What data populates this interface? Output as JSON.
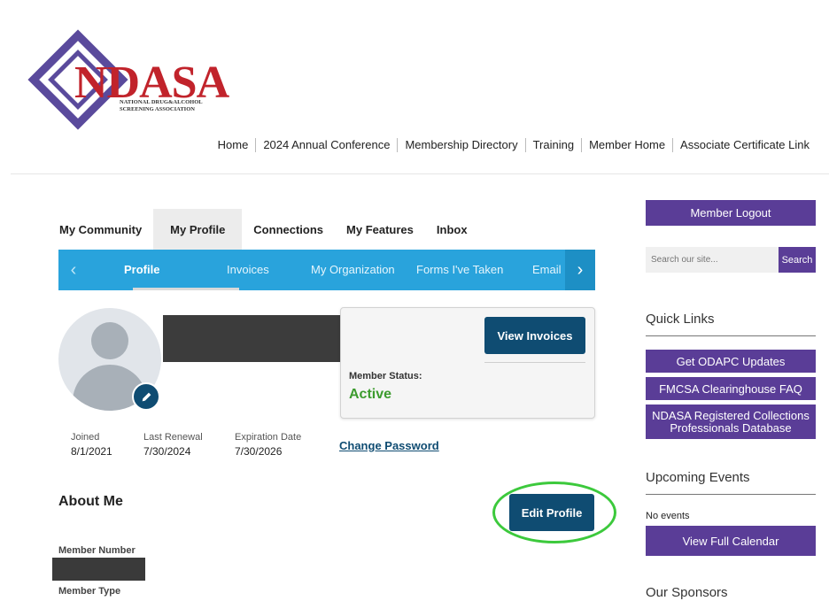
{
  "header": {
    "logo_text": "NDASA",
    "logo_subtitle_line1": "NATIONAL DRUG&ALCOHOL",
    "logo_subtitle_line2": "SCREENING ASSOCIATION",
    "nav": [
      "Home",
      "2024 Annual Conference",
      "Membership Directory",
      "Training",
      "Member Home",
      "Associate Certificate Link"
    ]
  },
  "community_tabs": [
    "My Community",
    "My Profile",
    "Connections",
    "My Features",
    "Inbox"
  ],
  "sub_tabs": [
    "Profile",
    "Invoices",
    "My Organization",
    "Forms I've Taken",
    "Email"
  ],
  "profile": {
    "view_invoices_label": "View Invoices",
    "member_status_label": "Member Status:",
    "member_status_value": "Active",
    "joined_label": "Joined",
    "joined_value": "8/1/2021",
    "last_renewal_label": "Last Renewal",
    "last_renewal_value": "7/30/2024",
    "expiration_label": "Expiration Date",
    "expiration_value": "7/30/2026",
    "change_password_label": "Change Password",
    "about_me_title": "About Me",
    "edit_profile_label": "Edit Profile",
    "member_number_label": "Member Number",
    "member_type_label": "Member Type"
  },
  "sidebar": {
    "logout_label": "Member Logout",
    "search_placeholder": "Search our site...",
    "search_button_label": "Search",
    "quick_links_title": "Quick Links",
    "quick_links": [
      "Get ODAPC Updates",
      "FMCSA Clearinghouse FAQ",
      "NDASA Registered Collections Professionals Database"
    ],
    "upcoming_events_title": "Upcoming Events",
    "no_events_text": "No events",
    "view_calendar_label": "View Full Calendar",
    "sponsors_title": "Our Sponsors"
  },
  "colors": {
    "purple": "#5a3d97",
    "tab_blue": "#29a3dc",
    "button_navy": "#0f4c72",
    "active_green": "#3c9b2e",
    "highlight_green": "#3cc93c",
    "logo_red": "#c1232b"
  }
}
